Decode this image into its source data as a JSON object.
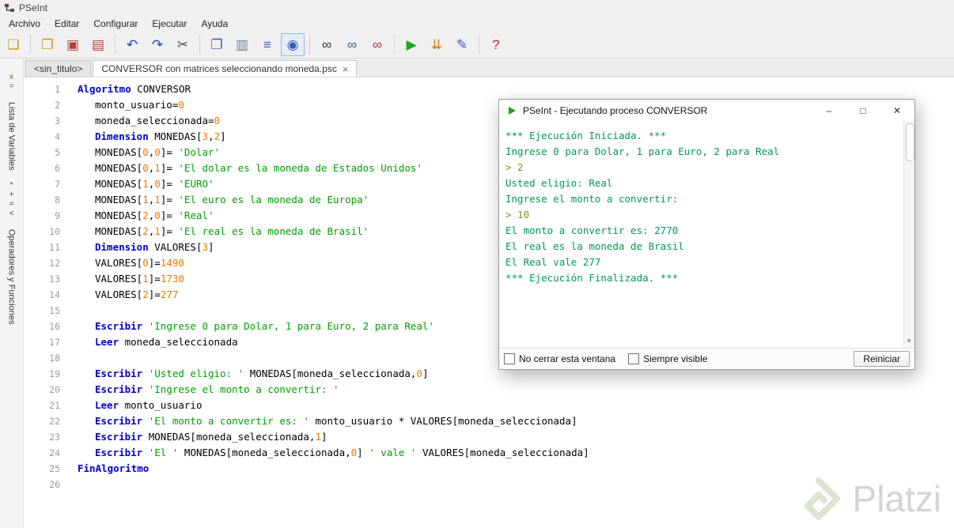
{
  "window": {
    "title": "PSeInt"
  },
  "menu": {
    "items": [
      {
        "id": "archivo",
        "label": "Archivo"
      },
      {
        "id": "editar",
        "label": "Editar"
      },
      {
        "id": "configurar",
        "label": "Configurar"
      },
      {
        "id": "ejecutar",
        "label": "Ejecutar"
      },
      {
        "id": "ayuda",
        "label": "Ayuda"
      }
    ]
  },
  "toolbar": {
    "groups": [
      [
        {
          "name": "new-file",
          "glyph": "❏",
          "color": "#c2a018"
        }
      ],
      [
        {
          "name": "open-file",
          "glyph": "❒",
          "color": "#d89010"
        },
        {
          "name": "save",
          "glyph": "▣",
          "color": "#b04040"
        },
        {
          "name": "save-all",
          "glyph": "▤",
          "color": "#b04040"
        }
      ],
      [
        {
          "name": "undo",
          "glyph": "↶",
          "color": "#2048c0"
        },
        {
          "name": "redo",
          "glyph": "↷",
          "color": "#2048c0"
        },
        {
          "name": "cut",
          "glyph": "✂",
          "color": "#4a4a4a"
        }
      ],
      [
        {
          "name": "copy",
          "glyph": "❐",
          "color": "#3858b8"
        },
        {
          "name": "paste",
          "glyph": "▥",
          "color": "#708098"
        },
        {
          "name": "indent",
          "glyph": "≡",
          "color": "#4060c0"
        },
        {
          "name": "zoom-view",
          "glyph": "◉",
          "color": "#3858b8",
          "pressed": true
        }
      ],
      [
        {
          "name": "find",
          "glyph": "∞",
          "color": "#383838"
        },
        {
          "name": "find-next",
          "glyph": "∞",
          "color": "#385898"
        },
        {
          "name": "find-replace",
          "glyph": "∞",
          "color": "#a03838"
        }
      ],
      [
        {
          "name": "run",
          "glyph": "▶",
          "color": "#18a818"
        },
        {
          "name": "run-step",
          "glyph": "⇊",
          "color": "#d07818"
        },
        {
          "name": "draw-flowchart",
          "glyph": "✎",
          "color": "#3858b8"
        }
      ],
      [
        {
          "name": "help",
          "glyph": "?",
          "color": "#d02020"
        }
      ]
    ]
  },
  "tabs": [
    {
      "id": "sin-titulo",
      "label": "<sin_titulo>",
      "active": false
    },
    {
      "id": "conversor",
      "label": "CONVERSOR con matrices seleccionando moneda.psc",
      "active": true,
      "close_glyph": "×"
    }
  ],
  "sidebar": {
    "variables_icon": "x=",
    "variables_label": "Lista de Variables",
    "operators_icon": "*+=<",
    "operators_label": "Operadores y Funciones"
  },
  "editor": {
    "lines": [
      {
        "n": 1,
        "indent": 0,
        "tokens": [
          [
            "kw",
            "Algoritmo"
          ],
          [
            "pl",
            " CONVERSOR"
          ]
        ]
      },
      {
        "n": 2,
        "indent": 1,
        "tokens": [
          [
            "pl",
            "monto_usuario="
          ],
          [
            "num",
            "0"
          ]
        ]
      },
      {
        "n": 3,
        "indent": 1,
        "tokens": [
          [
            "pl",
            "moneda_seleccionada="
          ],
          [
            "num",
            "0"
          ]
        ]
      },
      {
        "n": 4,
        "indent": 1,
        "tokens": [
          [
            "kw",
            "Dimension"
          ],
          [
            "pl",
            " MONEDAS["
          ],
          [
            "num",
            "3"
          ],
          [
            "pl",
            ","
          ],
          [
            "num",
            "2"
          ],
          [
            "pl",
            "]"
          ]
        ]
      },
      {
        "n": 5,
        "indent": 1,
        "tokens": [
          [
            "pl",
            "MONEDAS["
          ],
          [
            "num",
            "0"
          ],
          [
            "pl",
            ","
          ],
          [
            "num",
            "0"
          ],
          [
            "pl",
            "]= "
          ],
          [
            "str",
            "'Dolar'"
          ]
        ]
      },
      {
        "n": 6,
        "indent": 1,
        "tokens": [
          [
            "pl",
            "MONEDAS["
          ],
          [
            "num",
            "0"
          ],
          [
            "pl",
            ","
          ],
          [
            "num",
            "1"
          ],
          [
            "pl",
            "]= "
          ],
          [
            "str",
            "'El dolar es la moneda de Estados Unidos'"
          ]
        ]
      },
      {
        "n": 7,
        "indent": 1,
        "tokens": [
          [
            "pl",
            "MONEDAS["
          ],
          [
            "num",
            "1"
          ],
          [
            "pl",
            ","
          ],
          [
            "num",
            "0"
          ],
          [
            "pl",
            "]= "
          ],
          [
            "str",
            "'EURO'"
          ]
        ]
      },
      {
        "n": 8,
        "indent": 1,
        "tokens": [
          [
            "pl",
            "MONEDAS["
          ],
          [
            "num",
            "1"
          ],
          [
            "pl",
            ","
          ],
          [
            "num",
            "1"
          ],
          [
            "pl",
            "]= "
          ],
          [
            "str",
            "'El euro es la moneda de Europa'"
          ]
        ]
      },
      {
        "n": 9,
        "indent": 1,
        "tokens": [
          [
            "pl",
            "MONEDAS["
          ],
          [
            "num",
            "2"
          ],
          [
            "pl",
            ","
          ],
          [
            "num",
            "0"
          ],
          [
            "pl",
            "]= "
          ],
          [
            "str",
            "'Real'"
          ]
        ]
      },
      {
        "n": 10,
        "indent": 1,
        "tokens": [
          [
            "pl",
            "MONEDAS["
          ],
          [
            "num",
            "2"
          ],
          [
            "pl",
            ","
          ],
          [
            "num",
            "1"
          ],
          [
            "pl",
            "]= "
          ],
          [
            "str",
            "'El real es la moneda de Brasil'"
          ]
        ]
      },
      {
        "n": 11,
        "indent": 1,
        "tokens": [
          [
            "kw",
            "Dimension"
          ],
          [
            "pl",
            " VALORES["
          ],
          [
            "num",
            "3"
          ],
          [
            "pl",
            "]"
          ]
        ]
      },
      {
        "n": 12,
        "indent": 1,
        "tokens": [
          [
            "pl",
            "VALORES["
          ],
          [
            "num",
            "0"
          ],
          [
            "pl",
            "]="
          ],
          [
            "num",
            "1490"
          ]
        ]
      },
      {
        "n": 13,
        "indent": 1,
        "tokens": [
          [
            "pl",
            "VALORES["
          ],
          [
            "num",
            "1"
          ],
          [
            "pl",
            "]="
          ],
          [
            "num",
            "1730"
          ]
        ]
      },
      {
        "n": 14,
        "indent": 1,
        "tokens": [
          [
            "pl",
            "VALORES["
          ],
          [
            "num",
            "2"
          ],
          [
            "pl",
            "]="
          ],
          [
            "num",
            "277"
          ]
        ]
      },
      {
        "n": 15,
        "indent": 0,
        "tokens": []
      },
      {
        "n": 16,
        "indent": 1,
        "tokens": [
          [
            "kw",
            "Escribir"
          ],
          [
            "pl",
            " "
          ],
          [
            "str",
            "'Ingrese 0 para Dolar, 1 para Euro, 2 para Real'"
          ]
        ]
      },
      {
        "n": 17,
        "indent": 1,
        "tokens": [
          [
            "kw",
            "Leer"
          ],
          [
            "pl",
            " moneda_seleccionada"
          ]
        ]
      },
      {
        "n": 18,
        "indent": 0,
        "tokens": []
      },
      {
        "n": 19,
        "indent": 1,
        "tokens": [
          [
            "kw",
            "Escribir"
          ],
          [
            "pl",
            " "
          ],
          [
            "str",
            "'Usted eligio: '"
          ],
          [
            "pl",
            " MONEDAS[moneda_seleccionada,"
          ],
          [
            "num",
            "0"
          ],
          [
            "pl",
            "]"
          ]
        ]
      },
      {
        "n": 20,
        "indent": 1,
        "tokens": [
          [
            "kw",
            "Escribir"
          ],
          [
            "pl",
            " "
          ],
          [
            "str",
            "'Ingrese el monto a convertir: '"
          ]
        ]
      },
      {
        "n": 21,
        "indent": 1,
        "tokens": [
          [
            "kw",
            "Leer"
          ],
          [
            "pl",
            " monto_usuario"
          ]
        ]
      },
      {
        "n": 22,
        "indent": 1,
        "tokens": [
          [
            "kw",
            "Escribir"
          ],
          [
            "pl",
            " "
          ],
          [
            "str",
            "'El monto a convertir es: '"
          ],
          [
            "pl",
            " monto_usuario * VALORES[moneda_seleccionada]"
          ]
        ]
      },
      {
        "n": 23,
        "indent": 1,
        "tokens": [
          [
            "kw",
            "Escribir"
          ],
          [
            "pl",
            " MONEDAS[moneda_seleccionada,"
          ],
          [
            "num",
            "1"
          ],
          [
            "pl",
            "]"
          ]
        ]
      },
      {
        "n": 24,
        "indent": 1,
        "tokens": [
          [
            "kw",
            "Escribir"
          ],
          [
            "pl",
            " "
          ],
          [
            "str",
            "'El '"
          ],
          [
            "pl",
            " MONEDAS[moneda_seleccionada,"
          ],
          [
            "num",
            "0"
          ],
          [
            "pl",
            "] "
          ],
          [
            "str",
            "' vale '"
          ],
          [
            "pl",
            " VALORES[moneda_seleccionada]"
          ]
        ]
      },
      {
        "n": 25,
        "indent": 0,
        "tokens": [
          [
            "kw",
            "FinAlgoritmo"
          ]
        ]
      },
      {
        "n": 26,
        "indent": 0,
        "tokens": []
      }
    ]
  },
  "run_window": {
    "title": "PSeInt - Ejecutando proceso CONVERSOR",
    "controls": {
      "minimize": "–",
      "maximize": "□",
      "close": "✕"
    },
    "scroll_down_glyph": "▾",
    "console_lines": [
      {
        "type": "status",
        "text": "*** Ejecución Iniciada. ***"
      },
      {
        "type": "out",
        "text": "Ingrese 0 para Dolar, 1 para Euro, 2 para Real"
      },
      {
        "type": "in",
        "text": "> 2"
      },
      {
        "type": "out",
        "text": "Usted eligio: Real"
      },
      {
        "type": "out",
        "text": "Ingrese el monto a convertir:"
      },
      {
        "type": "in",
        "text": "> 10"
      },
      {
        "type": "out",
        "text": "El monto a convertir es: 2770"
      },
      {
        "type": "out",
        "text": "El real es la moneda de Brasil"
      },
      {
        "type": "out",
        "text": "El Real vale 277"
      },
      {
        "type": "status",
        "text": "*** Ejecución Finalizada. ***"
      }
    ],
    "footer": {
      "checkboxes": [
        {
          "name": "no-close-checkbox",
          "label": "No cerrar esta ventana",
          "checked": false
        },
        {
          "name": "always-visible-checkbox",
          "label": "Siempre visible",
          "checked": false
        }
      ],
      "button_label": "Reiniciar"
    }
  },
  "watermark": {
    "text": "Platzi"
  },
  "colors": {
    "keyword": "#0000cd",
    "string": "#00a000",
    "number": "#f07800",
    "console_text": "#009a53",
    "console_input": "#8b8b1a",
    "run_green": "#18a818",
    "brand_pale": "#dde5d0"
  }
}
